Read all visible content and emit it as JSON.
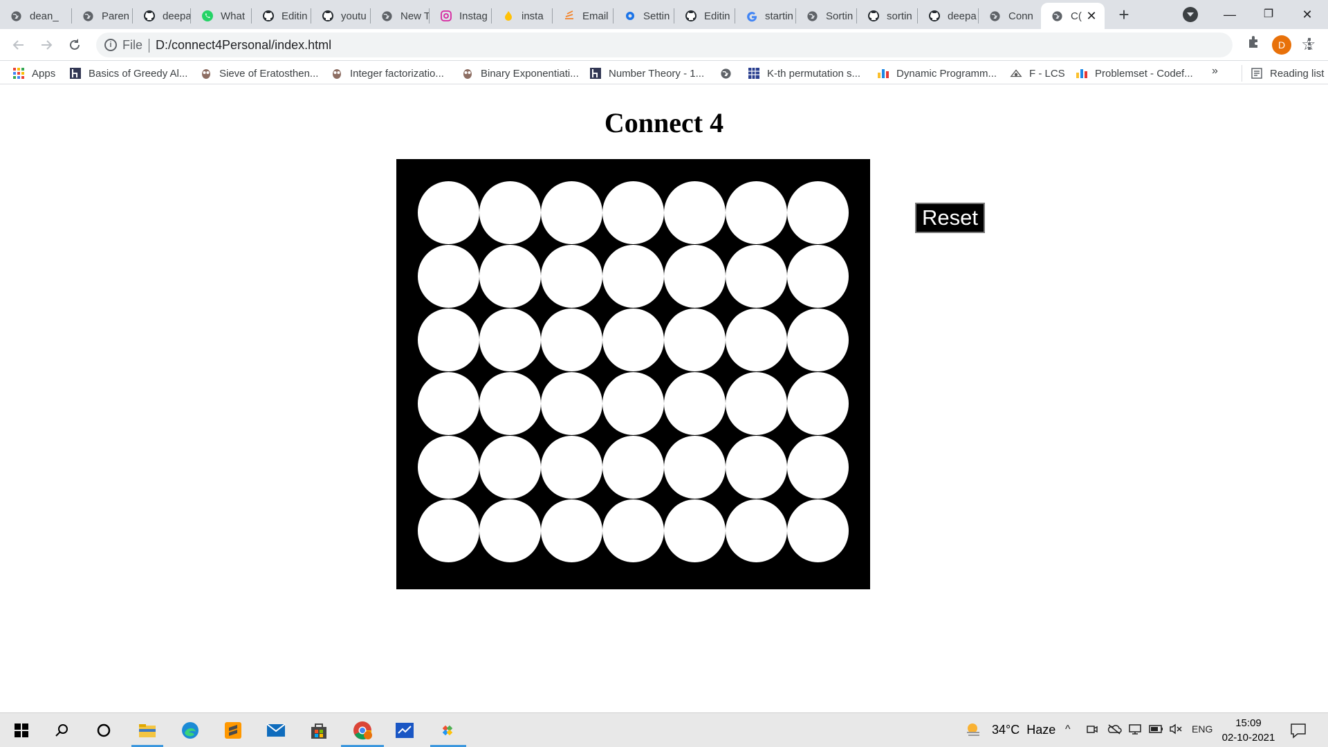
{
  "browser": {
    "tabs": [
      {
        "label": "dean_",
        "icon": "globe-icon"
      },
      {
        "label": "Paren",
        "icon": "globe-icon"
      },
      {
        "label": "deepa",
        "icon": "github-icon"
      },
      {
        "label": "What",
        "icon": "whatsapp-icon"
      },
      {
        "label": "Editin",
        "icon": "github-icon"
      },
      {
        "label": "youtu",
        "icon": "github-icon"
      },
      {
        "label": "New T",
        "icon": "globe-icon"
      },
      {
        "label": "Instag",
        "icon": "instagram-icon"
      },
      {
        "label": "insta",
        "icon": "flame-icon"
      },
      {
        "label": "Email",
        "icon": "stack-icon"
      },
      {
        "label": "Settin",
        "icon": "gear-icon"
      },
      {
        "label": "Editin",
        "icon": "github-icon"
      },
      {
        "label": "startin",
        "icon": "google-icon"
      },
      {
        "label": "Sortin",
        "icon": "globe-icon"
      },
      {
        "label": "sortin",
        "icon": "github-icon"
      },
      {
        "label": "deepa",
        "icon": "github-icon"
      },
      {
        "label": "Conn",
        "icon": "globe-icon"
      },
      {
        "label": "C(",
        "icon": "globe-icon",
        "active": true
      }
    ],
    "new_tab_symbol": "+",
    "tab_close_symbol": "✕",
    "window_controls": {
      "minimize": "—",
      "restore": "❐",
      "close": "✕"
    },
    "address": {
      "scheme_label": "File",
      "url": "D:/connect4Personal/index.html"
    },
    "profile_initial": "D",
    "bookmarks": [
      {
        "label": "Apps",
        "icon": "apps-grid-icon"
      },
      {
        "label": "Basics of Greedy Al...",
        "icon": "hackerearth-icon"
      },
      {
        "label": "Sieve of Eratosthen...",
        "icon": "owl-icon"
      },
      {
        "label": "Integer factorizatio...",
        "icon": "owl-icon"
      },
      {
        "label": "Binary Exponentiati...",
        "icon": "owl-icon"
      },
      {
        "label": "Number Theory - 1...",
        "icon": "hackerearth-icon"
      },
      {
        "label": "",
        "icon": "globe-icon"
      },
      {
        "label": "K-th permutation s...",
        "icon": "grid-icon"
      },
      {
        "label": "Dynamic Programm...",
        "icon": "codeforces-icon"
      },
      {
        "label": "F - LCS",
        "icon": "atcoder-icon"
      },
      {
        "label": "Problemset - Codef...",
        "icon": "codeforces-icon"
      }
    ],
    "bookmarks_more": "»",
    "reading_list": "Reading list"
  },
  "page": {
    "title": "Connect 4",
    "reset_label": "Reset",
    "board": {
      "rows": 6,
      "cols": 7
    }
  },
  "taskbar": {
    "apps": [
      "windows-start-icon",
      "search-icon",
      "cortana-icon",
      "file-explorer-icon",
      "edge-icon",
      "sublime-text-icon",
      "mail-icon",
      "store-icon",
      "chrome-icon",
      "whiteboard-icon",
      "git-icon"
    ],
    "weather": {
      "temp": "34°C",
      "condition": "Haze"
    },
    "language": "ENG",
    "time": "15:09",
    "date": "02-10-2021"
  }
}
